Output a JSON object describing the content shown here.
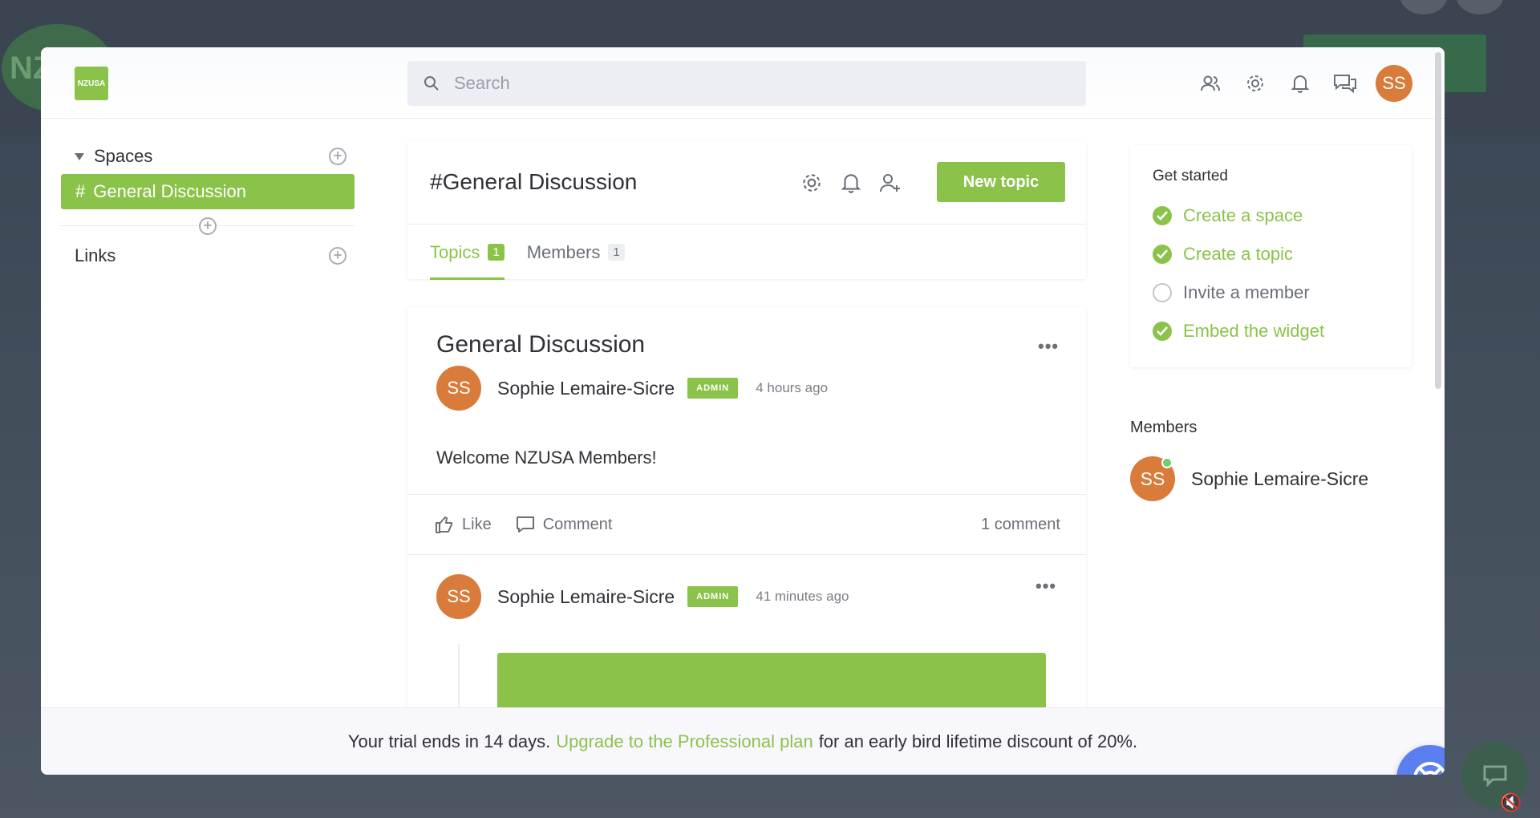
{
  "background": {
    "logo_text": "NZ"
  },
  "topbar": {
    "logo_text": "NZUSA",
    "search_placeholder": "Search",
    "user_initials": "SS"
  },
  "sidebar": {
    "spaces_label": "Spaces",
    "spaces": [
      {
        "hash": "#",
        "label": "General Discussion"
      }
    ],
    "links_label": "Links"
  },
  "channel": {
    "title": "#General Discussion",
    "new_topic_label": "New topic",
    "tabs": [
      {
        "label": "Topics",
        "count": "1",
        "active": true
      },
      {
        "label": "Members",
        "count": "1",
        "active": false
      }
    ]
  },
  "topic": {
    "title": "General Discussion",
    "posts": [
      {
        "initials": "SS",
        "author": "Sophie Lemaire-Sicre",
        "badge": "ADMIN",
        "time": "4 hours ago",
        "body": "Welcome NZUSA Members!"
      },
      {
        "initials": "SS",
        "author": "Sophie Lemaire-Sicre",
        "badge": "ADMIN",
        "time": "41 minutes ago"
      }
    ],
    "actions": {
      "like": "Like",
      "comment": "Comment",
      "comment_count": "1 comment"
    }
  },
  "get_started": {
    "title": "Get started",
    "items": [
      {
        "label": "Create a space",
        "done": true
      },
      {
        "label": "Create a topic",
        "done": true
      },
      {
        "label": "Invite a member",
        "done": false
      },
      {
        "label": "Embed the widget",
        "done": true
      }
    ]
  },
  "members": {
    "title": "Members",
    "list": [
      {
        "initials": "SS",
        "name": "Sophie Lemaire-Sicre",
        "online": true
      }
    ]
  },
  "trial": {
    "prefix": "Your trial ends in 14 days.",
    "link": "Upgrade to the Professional plan",
    "suffix": "for an early bird lifetime discount of 20%."
  },
  "colors": {
    "accent": "#8bc34a",
    "avatar": "#d97b3a",
    "help_button": "#5b7ff0"
  },
  "icons": [
    "search-icon",
    "members-icon",
    "gear-icon",
    "bell-icon",
    "chat-bubbles-icon",
    "add-user-icon",
    "thumbs-up-icon",
    "comment-icon",
    "check-icon",
    "lifebuoy-icon",
    "chevron-down-icon",
    "plus-circle-icon"
  ]
}
